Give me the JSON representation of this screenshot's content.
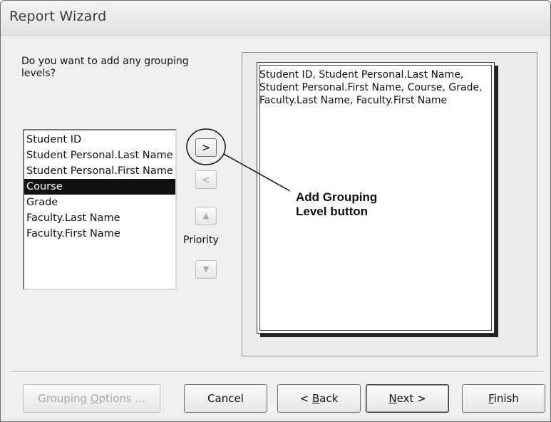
{
  "window": {
    "title": "Report Wizard"
  },
  "question": "Do you want to add any grouping levels?",
  "field_list": {
    "items": [
      {
        "label": "Student ID",
        "selected": false
      },
      {
        "label": "Student Personal.Last Name",
        "selected": false
      },
      {
        "label": "Student Personal.First Name",
        "selected": false
      },
      {
        "label": "Course",
        "selected": true
      },
      {
        "label": "Grade",
        "selected": false
      },
      {
        "label": "Faculty.Last Name",
        "selected": false
      },
      {
        "label": "Faculty.First Name",
        "selected": false
      }
    ]
  },
  "buttons": {
    "add_level": ">",
    "remove_level": "<",
    "priority_up": "▲",
    "priority_down": "▼",
    "priority_label": "Priority"
  },
  "preview": {
    "text": "Student ID, Student Personal.Last Name, Student Personal.First Name, Course, Grade, Faculty.Last Name, Faculty.First Name"
  },
  "callout": {
    "line1": "Add Grouping",
    "line2": "Level button"
  },
  "footer": {
    "grouping_options": {
      "pre": "Grouping ",
      "key": "O",
      "post": "ptions ..."
    },
    "cancel": "Cancel",
    "back": {
      "pre": "< ",
      "key": "B",
      "post": "ack"
    },
    "next": {
      "pre": "",
      "key": "N",
      "post": "ext >"
    },
    "finish": {
      "pre": "",
      "key": "F",
      "post": "inish"
    }
  }
}
